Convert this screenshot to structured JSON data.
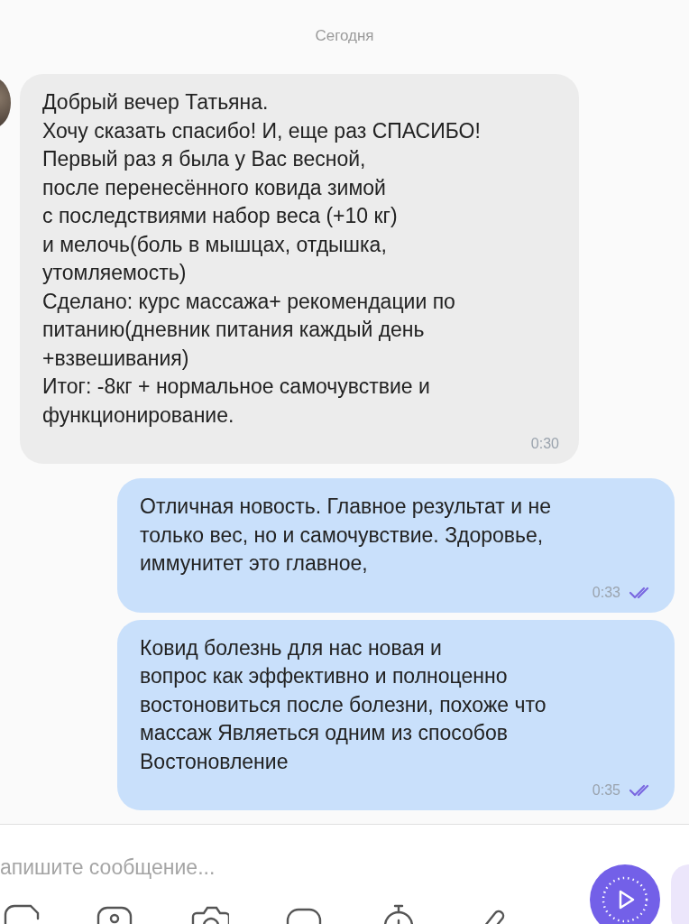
{
  "date_divider": "Сегодня",
  "messages": [
    {
      "outgoing": false,
      "text": "Добрый вечер Татьяна.\nХочу сказать спасибо! И, еще раз СПАСИБО!\nПервый раз я была у Вас весной,\nпосле перенесённого ковида зимой\nс последствиями набор веса (+10 кг)\nи мелочь(боль в мышцах, отдышка,\nутомляемость)\nСделано: курс массажа+ рекомендации по\nпитанию(дневник питания каждый день\n+взвешивания)\nИтог: -8кг + нормальное самочувствие и\nфункционирование.",
      "time": "0:30"
    },
    {
      "outgoing": true,
      "text": "Отличная новость. Главное результат и не\nтолько вес, но и самочувствие. Здоровье,\nиммунитет это главное,",
      "time": "0:33",
      "read": true
    },
    {
      "outgoing": true,
      "text": "Ковид болезнь для нас новая и\nвопрос как эффективно и полноценно\nвостоновиться после болезни, похоже что\nмассаж Являеться одним из  способов\nВостоновление",
      "time": "0:35",
      "read": true
    }
  ],
  "composer": {
    "placeholder": "апишите сообщение..."
  }
}
